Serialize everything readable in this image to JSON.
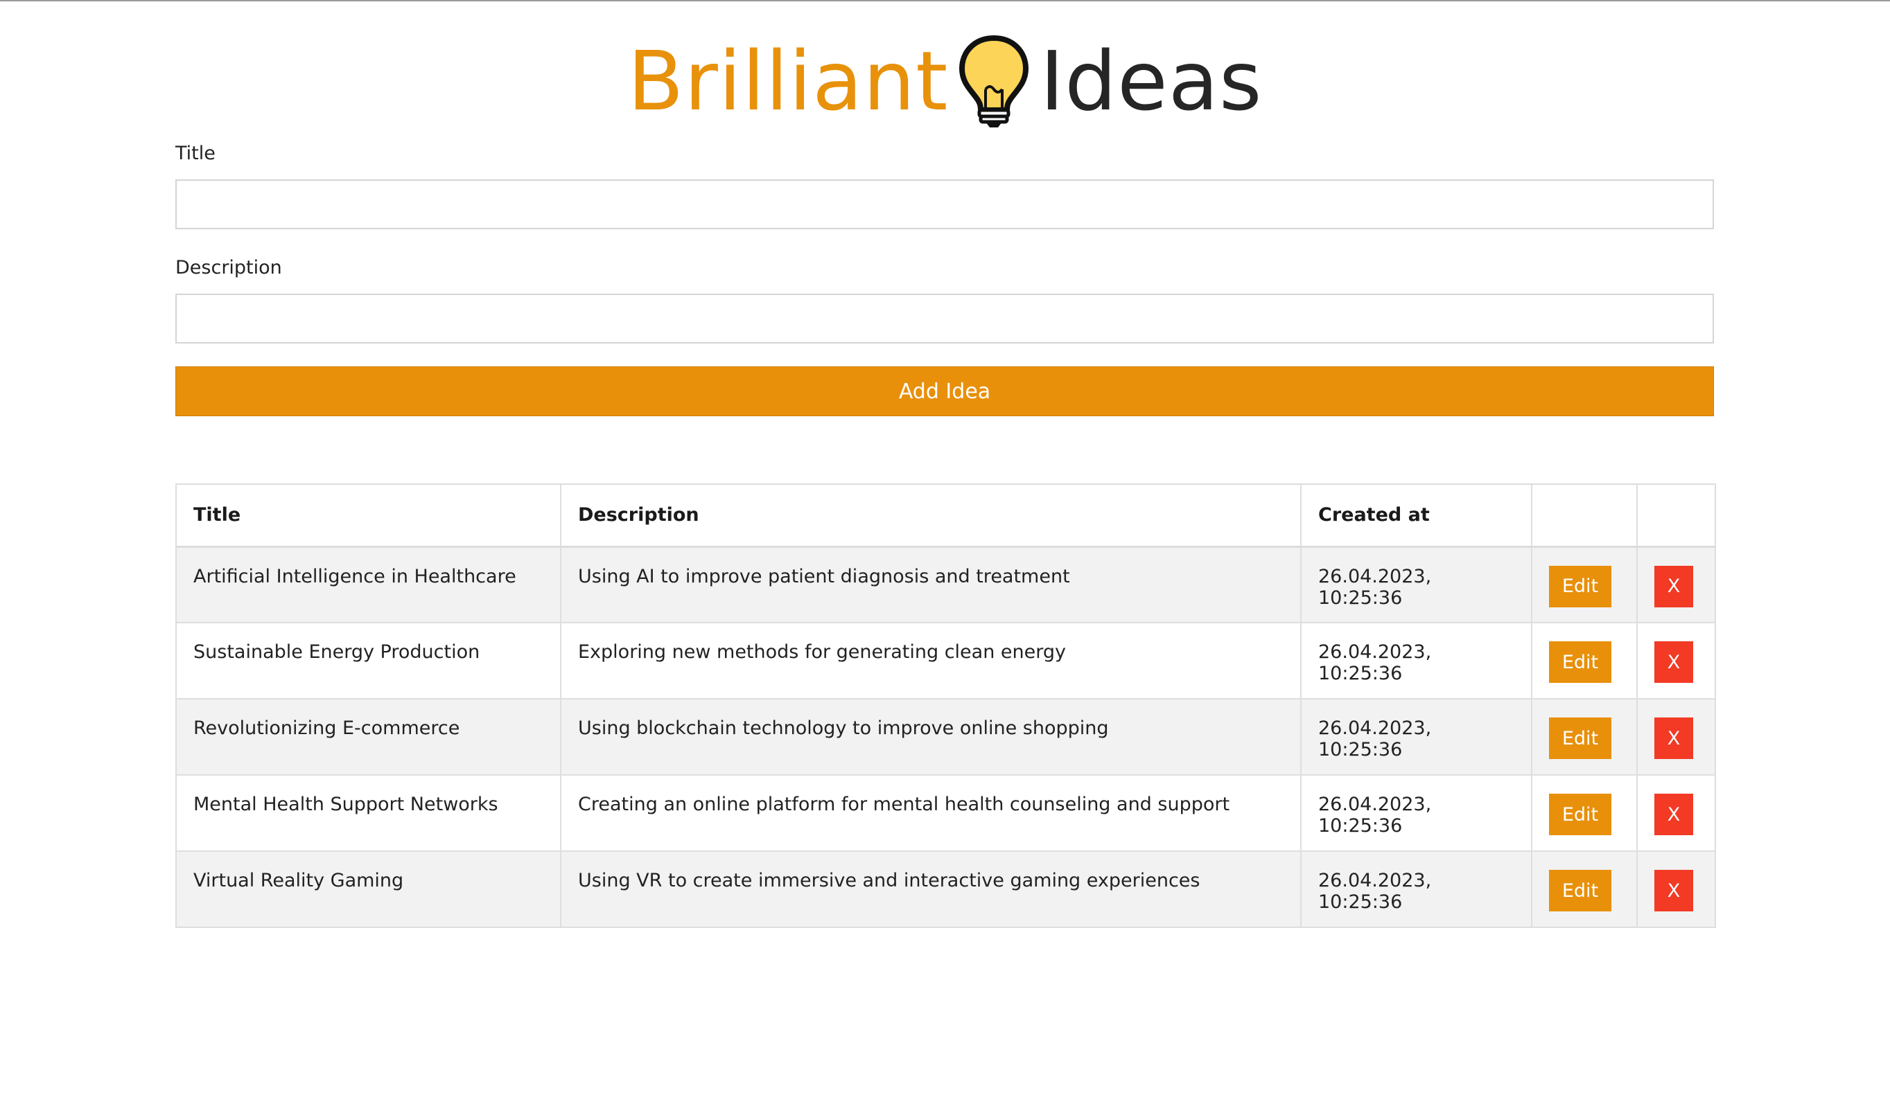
{
  "logo": {
    "word1": "Brilliant",
    "word2": "Ideas",
    "bulb_icon": "lightbulb-icon"
  },
  "form": {
    "title_label": "Title",
    "title_value": "",
    "description_label": "Description",
    "description_value": "",
    "submit_label": "Add Idea"
  },
  "colors": {
    "accent": "#e8900a",
    "danger": "#f23a25",
    "row_stripe": "#f2f2f2",
    "text": "#222222"
  },
  "table": {
    "columns": [
      "Title",
      "Description",
      "Created at",
      "",
      ""
    ],
    "rows": [
      {
        "title": "Artificial Intelligence in Healthcare",
        "description": "Using AI to improve patient diagnosis and treatment",
        "created_at": "26.04.2023, 10:25:36",
        "edit_label": "Edit",
        "delete_label": "X"
      },
      {
        "title": "Sustainable Energy Production",
        "description": "Exploring new methods for generating clean energy",
        "created_at": "26.04.2023, 10:25:36",
        "edit_label": "Edit",
        "delete_label": "X"
      },
      {
        "title": "Revolutionizing E-commerce",
        "description": "Using blockchain technology to improve online shopping",
        "created_at": "26.04.2023, 10:25:36",
        "edit_label": "Edit",
        "delete_label": "X"
      },
      {
        "title": "Mental Health Support Networks",
        "description": "Creating an online platform for mental health counseling and support",
        "created_at": "26.04.2023, 10:25:36",
        "edit_label": "Edit",
        "delete_label": "X"
      },
      {
        "title": "Virtual Reality Gaming",
        "description": "Using VR to create immersive and interactive gaming experiences",
        "created_at": "26.04.2023, 10:25:36",
        "edit_label": "Edit",
        "delete_label": "X"
      }
    ]
  }
}
